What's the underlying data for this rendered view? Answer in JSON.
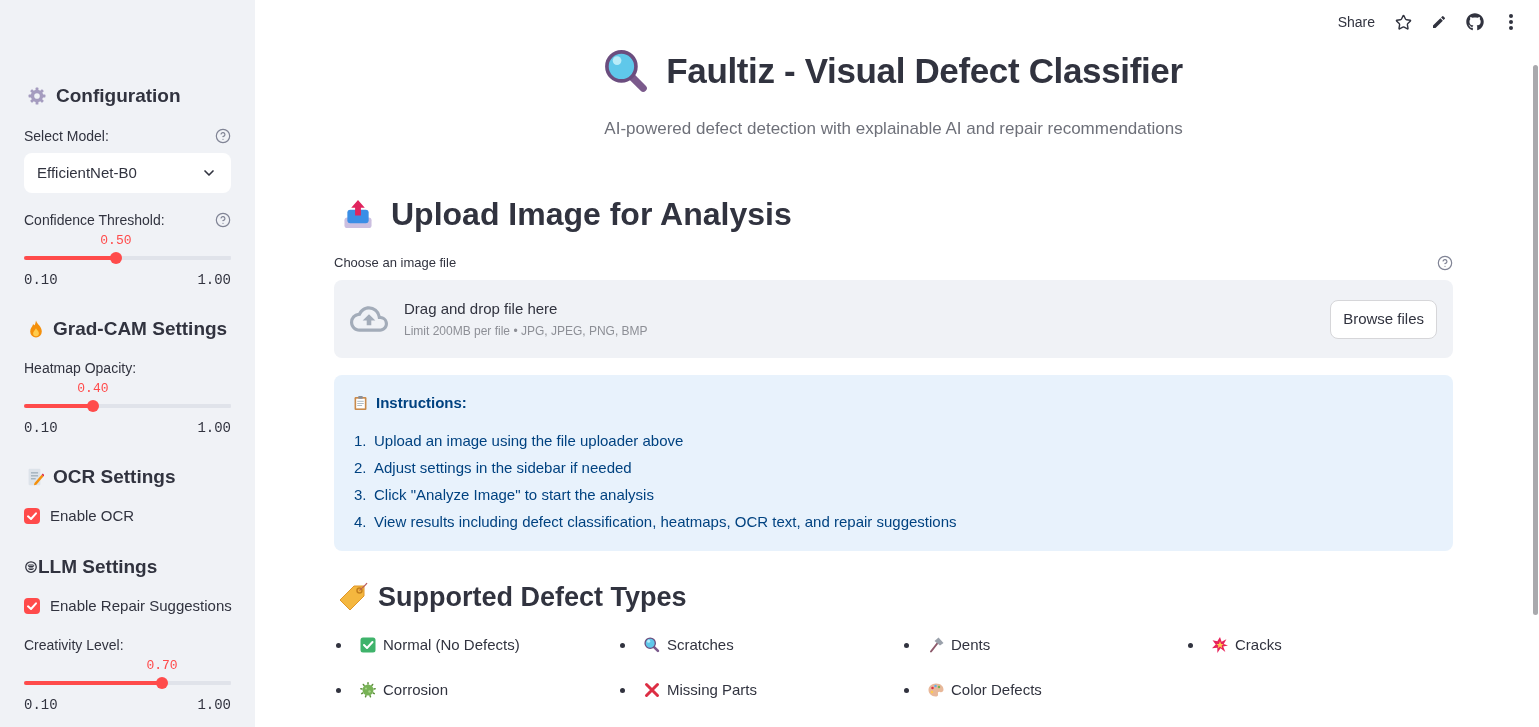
{
  "sidebar": {
    "configuration": {
      "title": "Configuration",
      "model_select": {
        "label": "Select Model:",
        "help": true,
        "value": "EfficientNet-B0"
      },
      "confidence": {
        "label": "Confidence Threshold:",
        "help": true,
        "reading": "0.50",
        "level": 0.444,
        "min": "0.10",
        "max": "1.00"
      }
    },
    "gradcam": {
      "title": "Grad-CAM Settings",
      "opacity": {
        "label": "Heatmap Opacity:",
        "reading": "0.40",
        "level": 0.333,
        "min": "0.10",
        "max": "1.00"
      }
    },
    "ocr": {
      "title": "OCR Settings",
      "enable": {
        "label": "Enable OCR",
        "checked": true
      }
    },
    "llm": {
      "title": "LLM Settings",
      "enable": {
        "label": "Enable Repair Suggestions",
        "checked": true
      },
      "creativity": {
        "label": "Creativity Level:",
        "reading": "0.70",
        "level": 0.667,
        "min": "0.10",
        "max": "1.00"
      }
    }
  },
  "toolbar": {
    "share": "Share"
  },
  "header": {
    "title": "Faultiz - Visual Defect Classifier",
    "subtitle": "AI-powered defect detection with explainable AI and repair recommendations"
  },
  "upload": {
    "heading": "Upload Image for Analysis",
    "label": "Choose an image file",
    "help": true,
    "dropzone": {
      "title": "Drag and drop file here",
      "hint": "Limit 200MB per file • JPG, JPEG, PNG, BMP"
    },
    "button": "Browse files"
  },
  "instructions": {
    "title": "Instructions:",
    "steps": [
      {
        "number": "1.",
        "text": "Upload an image using the file uploader above"
      },
      {
        "number": "2.",
        "text": "Adjust settings in the sidebar if needed"
      },
      {
        "number": "3.",
        "text": "Click \"Analyze Image\" to start the analysis"
      },
      {
        "number": "4.",
        "text": "View results including defect classification, heatmaps, OCR text, and repair suggestions"
      }
    ]
  },
  "defect_types": {
    "heading": "Supported Defect Types",
    "items": [
      {
        "kind": "check",
        "label": "Normal (No Defects)"
      },
      {
        "kind": "magnifier",
        "label": "Scratches"
      },
      {
        "kind": "hammer",
        "label": "Dents"
      },
      {
        "kind": "burst",
        "label": "Cracks"
      },
      {
        "kind": "microbe",
        "label": "Corrosion"
      },
      {
        "kind": "cross",
        "label": "Missing Parts"
      },
      {
        "kind": "palette",
        "label": "Color Defects"
      }
    ]
  }
}
